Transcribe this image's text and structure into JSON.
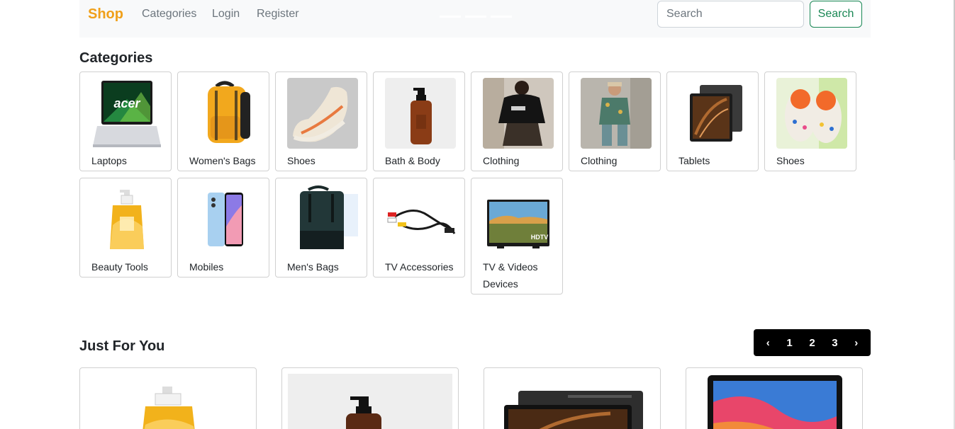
{
  "navbar": {
    "brand": "Shop",
    "links": [
      "Categories",
      "Login",
      "Register"
    ],
    "search_placeholder": "Search",
    "search_button": "Search"
  },
  "categories_section": {
    "title": "Categories",
    "items": [
      {
        "label": "Laptops",
        "icon": "laptop-image"
      },
      {
        "label": "Women's Bags",
        "icon": "backpack-image"
      },
      {
        "label": "Shoes",
        "icon": "sneaker-image"
      },
      {
        "label": "Bath & Body",
        "icon": "soap-bottle-image"
      },
      {
        "label": "Clothing",
        "icon": "clothing-model-image"
      },
      {
        "label": "Clothing",
        "icon": "clothing-model-image"
      },
      {
        "label": "Tablets",
        "icon": "tablet-image"
      },
      {
        "label": "Shoes",
        "icon": "clog-shoes-image"
      },
      {
        "label": "Beauty Tools",
        "icon": "lotion-bottle-image"
      },
      {
        "label": "Mobiles",
        "icon": "phone-image"
      },
      {
        "label": "Men's Bags",
        "icon": "backpack-image"
      },
      {
        "label": "TV Accessories",
        "icon": "av-cable-image"
      },
      {
        "label": "TV & Videos Devices",
        "icon": "television-image"
      }
    ]
  },
  "products_section": {
    "title": "Just For You",
    "pagination": {
      "prev": "‹",
      "pages": [
        "1",
        "2",
        "3"
      ],
      "next": "›"
    },
    "products": [
      {
        "icon": "lotion-bottle-image"
      },
      {
        "icon": "soap-bottle-image"
      },
      {
        "icon": "tablet-image"
      },
      {
        "icon": "laptop-image"
      }
    ]
  },
  "colors": {
    "brand": "#f0a01a",
    "search_button": "#198754",
    "pager_bg": "#000000"
  }
}
